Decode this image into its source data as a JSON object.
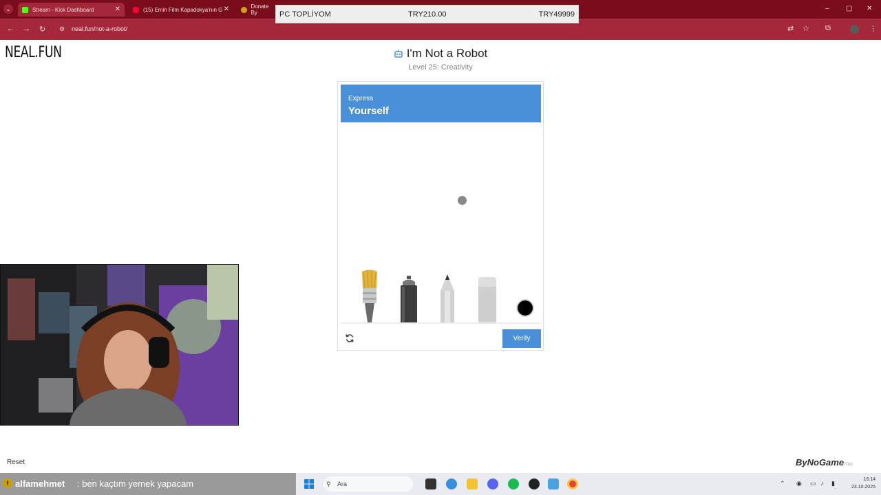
{
  "browser": {
    "tabs": [
      {
        "label": "Stream - Kick Dashboard",
        "favicon_color": "#53fc18"
      },
      {
        "label": "(15) Emin Film Kapadokya'nın G",
        "favicon_color": "#ff0033"
      },
      {
        "label": "Donate By",
        "favicon_color": "#d4a017"
      }
    ],
    "url": "neal.fun/not-a-robot/"
  },
  "overlay": {
    "label": "PC TOPLİYOM",
    "current": "TRY210.00",
    "goal": "TRY49999"
  },
  "site": {
    "logo": "NEAL.FUN"
  },
  "captcha": {
    "title": "I'm Not a Robot",
    "level": "Level 25: Creativity",
    "header_small": "Express",
    "header_big": "Yourself",
    "tools": [
      "brush-icon",
      "spray-can-icon",
      "pencil-icon",
      "eraser-icon",
      "color-picker-icon"
    ],
    "selected_color": "#000000",
    "verify_label": "Verify",
    "accent": "#4a90d9"
  },
  "page": {
    "reset_label": "Reset",
    "brand": "ByNoGame",
    "brand_suffix": "(TM)"
  },
  "chat": {
    "user": "alfamehmet",
    "message": ": ben kaçtım yemek yapacam"
  },
  "taskbar": {
    "search_placeholder": "Ara",
    "time": "16:14",
    "date": "23.10.2025"
  }
}
